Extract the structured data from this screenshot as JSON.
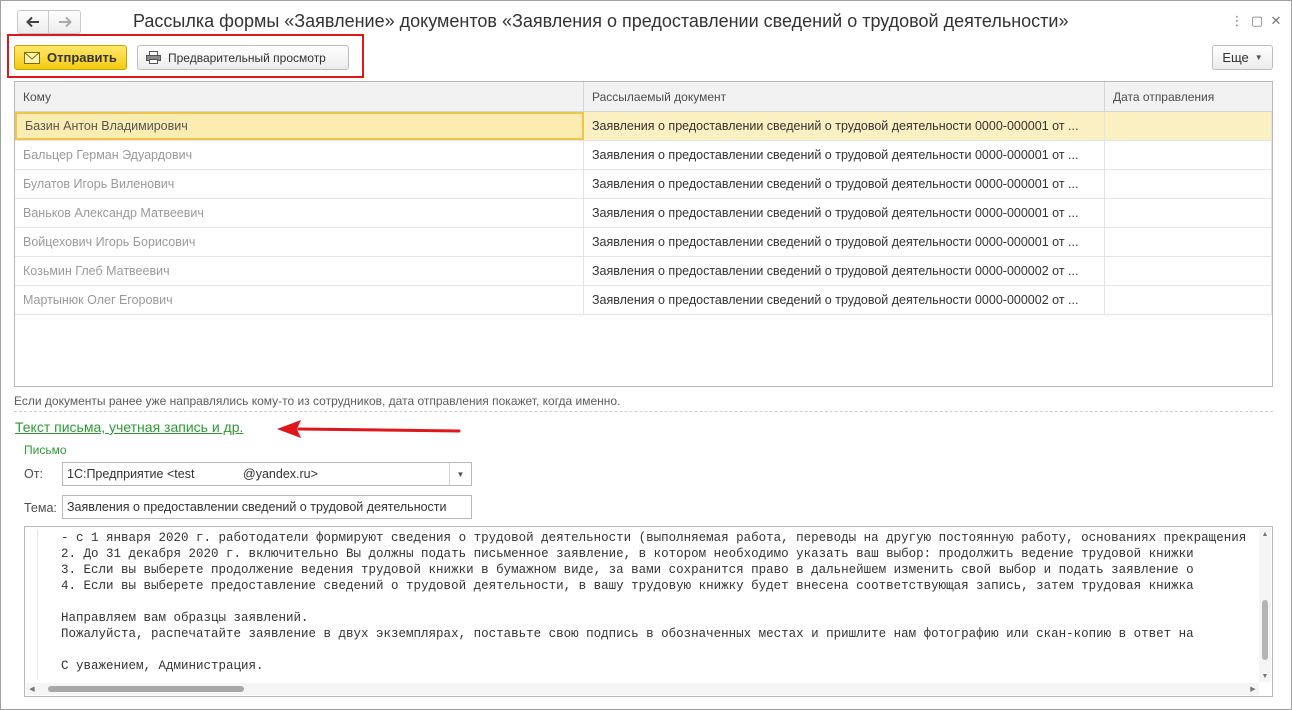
{
  "window": {
    "title": "Рассылка формы «Заявление» документов «Заявления о предоставлении сведений о трудовой деятельности»",
    "menu_icon": "⋮",
    "maximize_icon": "▢",
    "close_icon": "✕"
  },
  "toolbar": {
    "send_label": "Отправить",
    "preview_label": "Предварительный просмотр",
    "more_label": "Еще",
    "caret": "▼"
  },
  "table": {
    "columns": [
      "Кому",
      "Рассылаемый документ",
      "Дата отправления"
    ],
    "rows": [
      {
        "recipient": "Базин Антон Владимирович",
        "document": "Заявления о предоставлении сведений о трудовой деятельности 0000-000001 от ...",
        "date": ""
      },
      {
        "recipient": "Бальцер Герман Эдуардович",
        "document": "Заявления о предоставлении сведений о трудовой деятельности 0000-000001 от ...",
        "date": ""
      },
      {
        "recipient": "Булатов Игорь Виленович",
        "document": "Заявления о предоставлении сведений о трудовой деятельности 0000-000001 от ...",
        "date": ""
      },
      {
        "recipient": "Ваньков Александр Матвеевич",
        "document": "Заявления о предоставлении сведений о трудовой деятельности 0000-000001 от ...",
        "date": ""
      },
      {
        "recipient": "Войцехович Игорь Борисович",
        "document": "Заявления о предоставлении сведений о трудовой деятельности 0000-000001 от ...",
        "date": ""
      },
      {
        "recipient": "Козьмин Глеб Матвеевич",
        "document": "Заявления о предоставлении сведений о трудовой деятельности 0000-000002 от ...",
        "date": ""
      },
      {
        "recipient": "Мартынюк Олег Егорович",
        "document": "Заявления о предоставлении сведений о трудовой деятельности 0000-000002 от ...",
        "date": ""
      }
    ]
  },
  "hint": "Если документы ранее уже направлялись кому-то из сотрудников, дата отправления покажет, когда именно.",
  "link_text": "Текст письма, учетная запись и др.",
  "letter": {
    "group_title": "Письмо",
    "from_label": "От:",
    "from_value": "1С:Предприятие <test              @yandex.ru>",
    "topic_label": "Тема:",
    "topic_value": "Заявления о предоставлении сведений о трудовой деятельности",
    "body_lines": [
      "- с 1 января 2020 г. работодатели формируют сведения о трудовой деятельности (выполняемая работа, переводы на другую постоянную работу, основаниях прекращения",
      "2. До 31 декабря 2020 г. включительно Вы должны подать письменное заявление, в котором необходимо указать ваш выбор: продолжить ведение трудовой книжки",
      "3. Если вы выберете продолжение ведения трудовой книжки в бумажном виде, за вами сохранится право в дальнейшем изменить свой выбор и подать заявление о",
      "4. Если вы выберете предоставление сведений о трудовой деятельности, в вашу трудовую книжку будет внесена соответствующая запись, затем трудовая книжка",
      "",
      "Направляем вам образцы заявлений.",
      "Пожалуйста, распечатайте заявление в двух экземплярах, поставьте свою подпись в обозначенных местах и пришлите нам фотографию или скан-копию в ответ на",
      "",
      "С уважением, Администрация."
    ]
  },
  "colors": {
    "highlight_border": "#e0161d",
    "send_button": "#f4cc12",
    "link": "#2e9a36",
    "selected_row": "#fbf0c2",
    "annotation_arrow": "#e0161d"
  }
}
